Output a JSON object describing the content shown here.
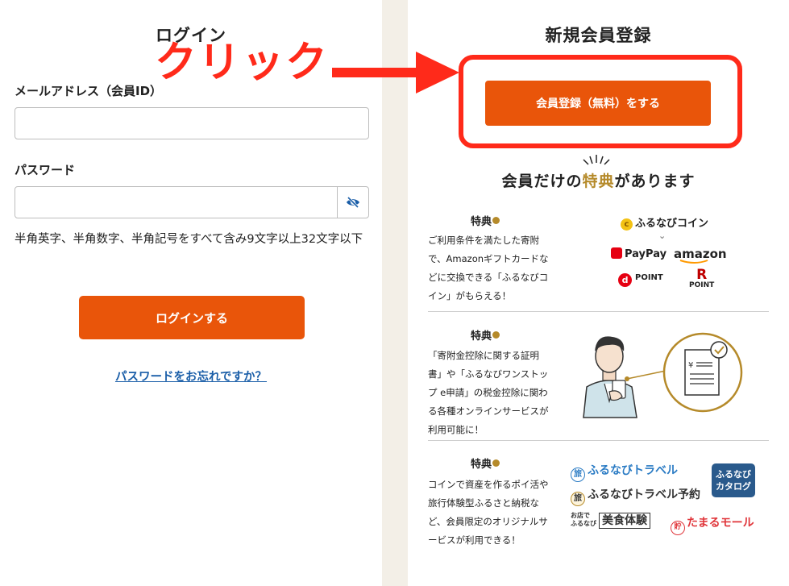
{
  "login": {
    "title": "ログイン",
    "email_label": "メールアドレス（会員ID）",
    "email_value": "",
    "password_label": "パスワード",
    "password_value": "",
    "password_hint": "半角英字、半角数字、半角記号をすべて含み9文字以上32文字以下",
    "login_button": "ログインする",
    "forgot_link": "パスワードをお忘れですか？"
  },
  "annotation": {
    "label": "クリック",
    "color": "#ff2a1a"
  },
  "register": {
    "title": "新規会員登録",
    "button": "会員登録（無料）をする",
    "benefits_heading_prefix": "会員だけの",
    "benefits_heading_highlight": "特典",
    "benefits_heading_suffix": "があります",
    "benefits": [
      {
        "title": "特典",
        "number": "1",
        "description": "ご利用条件を満たした寄附で、Amazonギフトカードなどに交換できる「ふるなびコイン」がもらえる！",
        "logos": [
          "ふるなびコイン",
          "PayPay",
          "amazon",
          "POINT",
          "POINT"
        ]
      },
      {
        "title": "特典",
        "number": "2",
        "description": "「寄附金控除に関する証明書」や「ふるなびワンストップ e申請」の税金控除に関わる各種オンラインサービスが利用可能に！",
        "illustration_currency": "¥"
      },
      {
        "title": "特典",
        "number": "3",
        "description": "コインで資産を作るポイ活や旅行体験型ふるさと納税など、会員限定のオリジナルサービスが利用できる！",
        "logos": [
          "ふるなびトラベル",
          "ふるなびトラベル予約",
          "ふるなび カタログ",
          "お店で ふるなび",
          "美食体験",
          "たまるモール"
        ]
      }
    ]
  },
  "colors": {
    "accent": "#e9550a",
    "gold": "#b58a2a",
    "link": "#1a5ea8",
    "background": "#f3efe7"
  },
  "icons": {
    "password_toggle": "eye-slash-icon"
  }
}
